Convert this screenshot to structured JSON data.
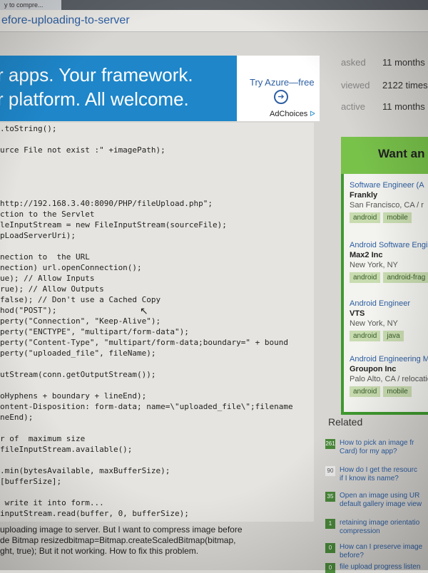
{
  "browser": {
    "tab_title": "y to compre..."
  },
  "page": {
    "title": "efore-uploading-to-server"
  },
  "ad": {
    "line1": "r apps. Your framework.",
    "line2": "r platform. All welcome.",
    "cta": "Try Azure—free",
    "arrow_icon": "➔",
    "adchoices": "AdChoices",
    "adchoices_icon": "ᐅ"
  },
  "code_lines": [
    ".toString();",
    "",
    "urce File not exist :\" +imagePath);",
    "",
    "",
    "",
    "",
    "http://192.168.3.40:8090/PHP/fileUpload.php\";",
    "ction to the Servlet",
    "leInputStream = new FileInputStream(sourceFile);",
    "pLoadServerUri);",
    "",
    "nection to  the URL",
    "nection) url.openConnection();",
    "ue); // Allow Inputs",
    "rue); // Allow Outputs",
    "false); // Don't use a Cached Copy",
    "hod(\"POST\");",
    "perty(\"Connection\", \"Keep-Alive\");",
    "perty(\"ENCTYPE\", \"multipart/form-data\");",
    "perty(\"Content-Type\", \"multipart/form-data;boundary=\" + bound",
    "perty(\"uploaded_file\", fileName);",
    "",
    "utStream(conn.getOutputStream());",
    "",
    "oHyphens + boundary + lineEnd);",
    "ontent-Disposition: form-data; name=\\\"uploaded_file\\\";filename",
    "neEnd);",
    "",
    "r of  maximum size",
    "fileInputStream.available();",
    "",
    ".min(bytesAvailable, maxBufferSize);",
    "[bufferSize];",
    "",
    " write it into form...",
    "inputStream.read(buffer, 0, bufferSize);"
  ],
  "question_text": [
    "uploading image to server. But I want to compress image before",
    "de Bitmap resizedbitmap=Bitmap.createScaledBitmap(bitmap,",
    "ght, true); But it not working. How to fix this problem."
  ],
  "stats": {
    "asked_label": "asked",
    "asked_value": "11 months",
    "viewed_label": "viewed",
    "viewed_value": "2122 times",
    "active_label": "active",
    "active_value": "11 months"
  },
  "jobs": {
    "title": "Want an",
    "items": [
      {
        "title": "Software Engineer (A",
        "company": "Frankly",
        "location": "San Francisco, CA / r",
        "tags": [
          "android",
          "mobile"
        ]
      },
      {
        "title": "Android Software Engi",
        "company": "Max2 Inc",
        "location": "New York, NY",
        "tags": [
          "android",
          "android-frag"
        ]
      },
      {
        "title": "Android Engineer",
        "company": "VTS",
        "location": "New York, NY",
        "tags": [
          "android",
          "java"
        ]
      },
      {
        "title": "Android Engineering Man",
        "company": "Groupon Inc",
        "location": "Palo Alto, CA / relocation",
        "tags": [
          "android",
          "mobile"
        ]
      }
    ]
  },
  "related": {
    "title": "Related",
    "items": [
      {
        "score": "261",
        "line1": "How to pick an image fr",
        "line2": "Card) for my app?"
      },
      {
        "score": "90",
        "line1": "How do I get the resourc",
        "line2": "if I know its name?"
      },
      {
        "score": "35",
        "line1": "Open an image using UR",
        "line2": "default gallery image view"
      },
      {
        "score": "1",
        "line1": "retaining image orientatio",
        "line2": "compression"
      },
      {
        "score": "0",
        "line1": "How can I preserve image",
        "line2": "before?"
      },
      {
        "score": "0",
        "line1": "file upload progress listen",
        "line2": ""
      }
    ]
  }
}
